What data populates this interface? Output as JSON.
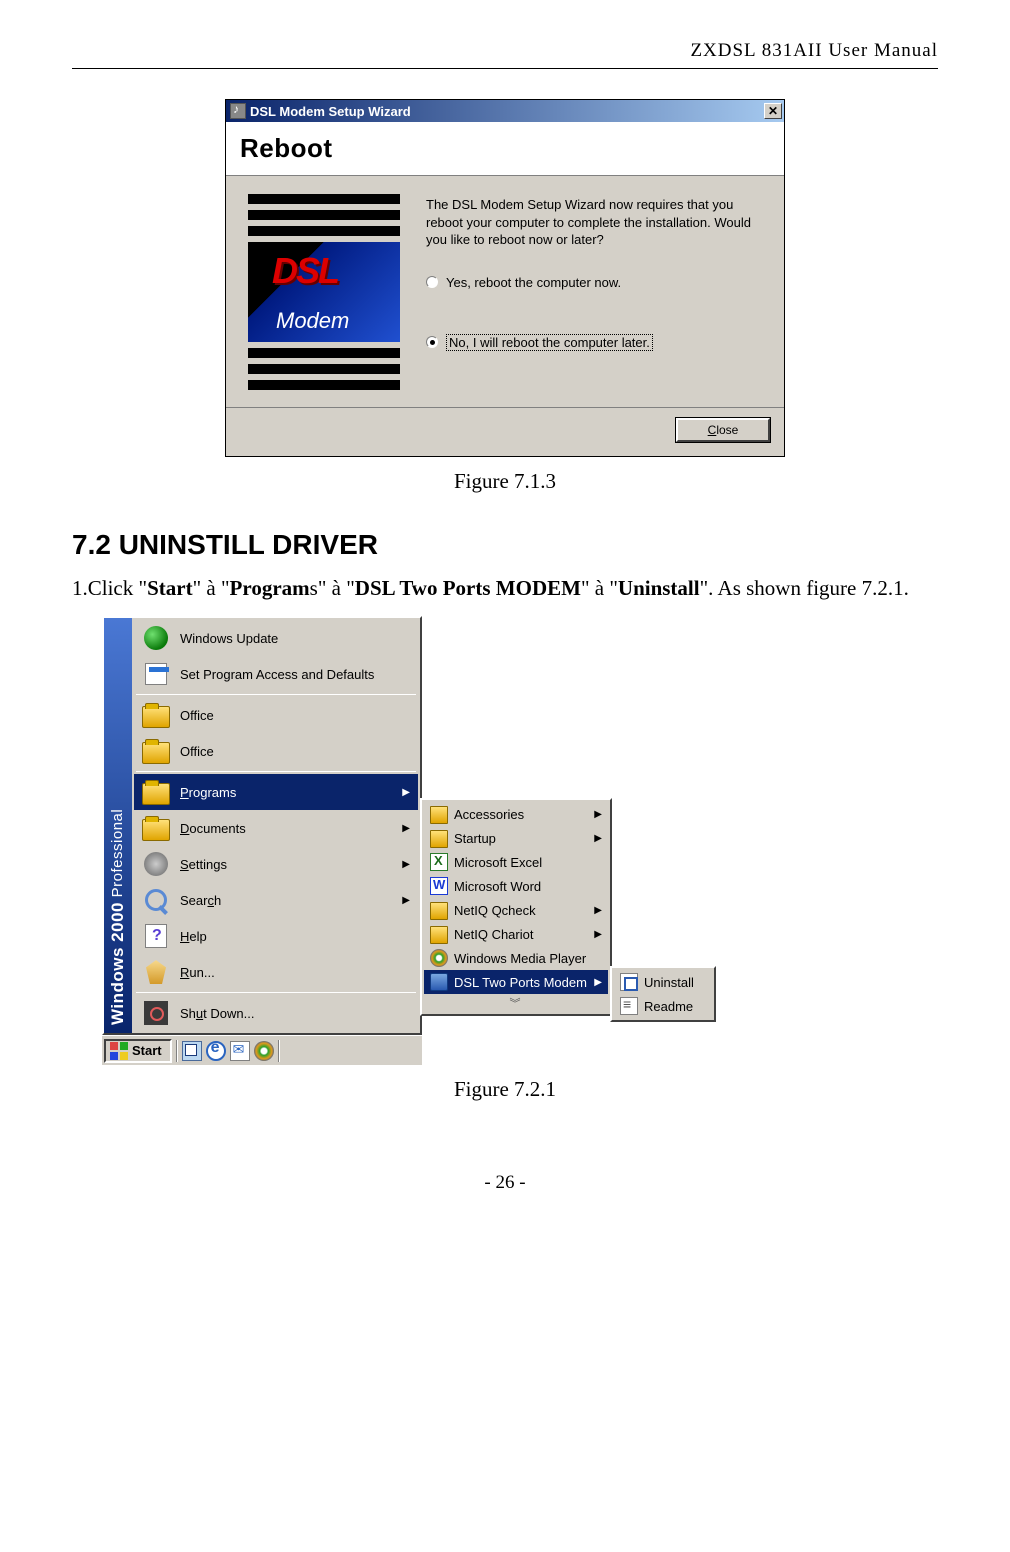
{
  "header": {
    "title": "ZXDSL 831AII User Manual"
  },
  "footer": {
    "page": "- 26 -"
  },
  "figure1": {
    "caption": "Figure 7.1.3"
  },
  "figure2": {
    "caption": "Figure 7.2.1"
  },
  "section": {
    "heading": "7.2 UNINSTILL DRIVER"
  },
  "instruction": {
    "prefix": "1.Click \"",
    "start": "Start",
    "sep1": "\" à \"",
    "program_pre": "Program",
    "program_suf": "s",
    "sep2": "\" à \"",
    "modem": "DSL Two Ports MODEM",
    "sep3": "\" à \"",
    "uninstall": "Uninstall",
    "suffix": "\". As shown figure 7.2.1."
  },
  "wizard": {
    "title": "DSL Modem Setup Wizard",
    "banner": "Reboot",
    "splash_top": "DSL",
    "splash_bottom": "Modem",
    "message": "The DSL Modem Setup Wizard now requires that you reboot your computer to complete the installation.  Would you like to reboot now or later?",
    "radio_yes": "Yes, reboot the computer now.",
    "radio_no": "No, I will reboot the computer later.",
    "close_x": "✕",
    "btn_close_pre": "",
    "btn_close_u": "C",
    "btn_close_post": "lose"
  },
  "startmenu": {
    "stripe_bold": "Windows 2000",
    "stripe_light": " Professional",
    "items": [
      {
        "label": "Windows Update"
      },
      {
        "label": "Set Program Access and Defaults"
      },
      {
        "label": "Office"
      },
      {
        "label": "Office"
      },
      {
        "u": "P",
        "rest": "rograms"
      },
      {
        "u": "D",
        "rest": "ocuments"
      },
      {
        "u": "S",
        "rest": "ettings"
      },
      {
        "u": "",
        "pre": "Sear",
        "u2": "c",
        "rest": "h"
      },
      {
        "u": "H",
        "rest": "elp"
      },
      {
        "u": "R",
        "rest": "un..."
      },
      {
        "u": "",
        "pre": "Sh",
        "u2": "u",
        "rest": "t Down..."
      }
    ],
    "sub1": {
      "acc": "Accessories",
      "startup": "Startup",
      "excel": "Microsoft Excel",
      "word": "Microsoft Word",
      "qcheck": "NetIQ Qcheck",
      "chariot": "NetIQ Chariot",
      "wmp": "Windows Media Player",
      "dsl": "DSL Two Ports Modem",
      "chev": "˅"
    },
    "sub2": {
      "uninstall": "Uninstall",
      "readme": "Readme"
    },
    "taskbar": {
      "start": "Start"
    }
  }
}
